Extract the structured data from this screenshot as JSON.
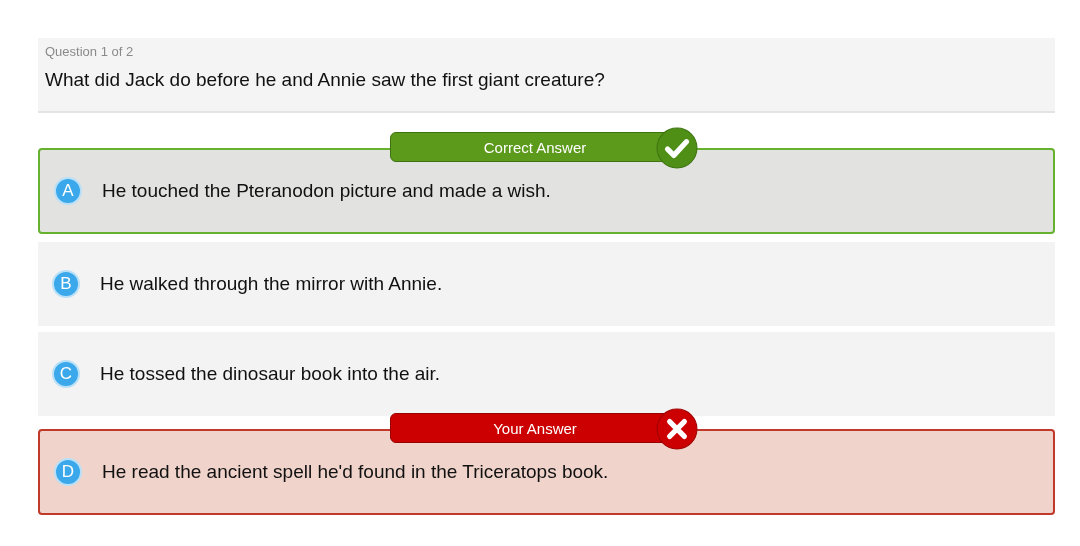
{
  "question": {
    "counter": "Question 1 of 2",
    "text": "What did Jack do before he and Annie saw the first giant creature?"
  },
  "options": [
    {
      "letter": "A",
      "text": "He touched the Pteranodon picture and made a wish.",
      "correct": true,
      "chosen": false,
      "banner": "Correct Answer"
    },
    {
      "letter": "B",
      "text": "He walked through the mirror with Annie.",
      "correct": false,
      "chosen": false
    },
    {
      "letter": "C",
      "text": "He tossed the dinosaur book into the air.",
      "correct": false,
      "chosen": false
    },
    {
      "letter": "D",
      "text": "He read the ancient spell he'd found in the Triceratops book.",
      "correct": false,
      "chosen": true,
      "banner": "Your Answer"
    }
  ]
}
